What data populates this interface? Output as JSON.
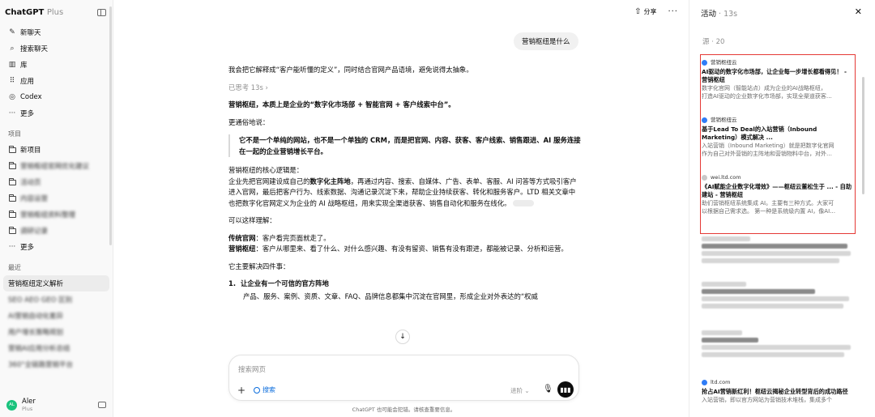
{
  "sidebar": {
    "brand": "ChatGPT",
    "brand_plan": "Plus",
    "nav": [
      {
        "label": "新聊天",
        "icon": "new-chat-icon"
      },
      {
        "label": "搜索聊天",
        "icon": "search-icon"
      },
      {
        "label": "库",
        "icon": "library-icon"
      },
      {
        "label": "应用",
        "icon": "apps-icon"
      },
      {
        "label": "Codex",
        "icon": "codex-icon"
      },
      {
        "label": "更多",
        "icon": "more-icon"
      }
    ],
    "projects_header": "项目",
    "projects": [
      {
        "label": "新项目",
        "icon": "new-folder-icon"
      },
      {
        "label": "营销枢纽官网优化建议"
      },
      {
        "label": "活动页"
      },
      {
        "label": "内容运营"
      },
      {
        "label": "营销枢纽资料整理"
      },
      {
        "label": "调研记录"
      }
    ],
    "projects_more": "更多",
    "recent_header": "最近",
    "recent": [
      {
        "label": "营销枢纽定义解析",
        "active": true
      },
      {
        "label": "SEO AEO GEO 区别"
      },
      {
        "label": "AI营销自动化差异"
      },
      {
        "label": "用户增长策略规划"
      },
      {
        "label": "营销AI应用分析总结"
      },
      {
        "label": "360°全链路营销平台"
      }
    ],
    "user": {
      "name": "Aler",
      "plan": "Plus",
      "initials": "AL"
    }
  },
  "topbar": {
    "share_label": "分享",
    "more_label": "···"
  },
  "conversation": {
    "user_message": "营销枢纽是什么",
    "intro": "我会把它解释成“客户能听懂的定义”，同时结合官网产品语境，避免说得太抽象。",
    "thought": "已思考 13s ›",
    "headline": "营销枢纽，本质上是企业的“数字化市场部 + 智能官网 + 客户线索中台”。",
    "plain_lead": "更通俗地说：",
    "quote": "它不是一个单纯的网站，也不是一个单独的 CRM，而是把官网、内容、获客、客户线索、销售跟进、AI 服务连接在一起的企业营销增长平台。",
    "core_lead": "营销枢纽的核心逻辑是：",
    "core_p1": "企业先把官网建设成自己的",
    "core_bold": "数字化主阵地",
    "core_p2": "，再通过内容、搜索、自媒体、广告、表单、客服、AI 问答等方式吸引客户进入官网，最后把客户行为、线索数据、沟通记录沉淀下来，帮助企业持续获客、转化和服务客户。LTD 相关文章中也把数字化官网定义为企业的 AI 战略枢纽，用来实现全渠道获客、销售自动化和服务在线化。",
    "understand_lead": "可以这样理解：",
    "trad_label": "传统官网",
    "trad_text": "：客户看完页面就走了。",
    "hub_label": "营销枢纽",
    "hub_text": "：客户从哪里来、看了什么、对什么感兴趣、有没有留资、销售有没有跟进，都能被记录、分析和运营。",
    "solves_lead": "它主要解决四件事：",
    "item1_num": "1.",
    "item1_title": "让企业有一个可信的官方阵地",
    "item1_text": "产品、服务、案例、资质、文章、FAQ、品牌信息都集中沉淀在官网里，形成企业对外表达的“权威"
  },
  "composer": {
    "placeholder": "搜索网页",
    "plus_label": "+",
    "search_label": "搜索",
    "think_label": "进阶 ⌄"
  },
  "disclaimer": "ChatGPT 也可能会犯错。请核查重要信息。",
  "activity": {
    "title": "活动",
    "duration": "· 13s",
    "sources_label": "源 · 20",
    "sources": [
      {
        "site": "营销枢纽云",
        "title": "AI驱动的数字化市场部，让企业每一步增长都看得见！ - 营销枢纽",
        "snippet1": "数字化官网（智能站点）成为企业的AI战略枢纽，",
        "snippet2": "打造AI驱动的企业数字化市场部，实现全渠道获客…"
      },
      {
        "site": "营销枢纽云",
        "title": "基于Lead To Deal的入站营销（Inbound Marketing）模式解决 ...",
        "snippet1": "入站营销（Inbound Marketing）就是把数字化官网",
        "snippet2": "作为自己对外营销的主阵地和营销物料中台，对外…"
      },
      {
        "site": "wei.ltd.com",
        "title": "《AI赋能企业数字化增效》——枢纽云董松生于 ... - 自助建站 - 营销枢纽",
        "snippet1": "助们营销枢纽系统集成 AI。主要有三种方式。大家可",
        "snippet2": "以根据自己需求选。 第一种是系统级内置 AI，像AI…"
      },
      {
        "site": "ltd.com",
        "title": "抢占AI营销新红利！枢纽云揭秘企业转型背后的成功路径",
        "snippet1": "入站营销，即以官方网站为营销技术堆栈，集成多个"
      }
    ]
  }
}
